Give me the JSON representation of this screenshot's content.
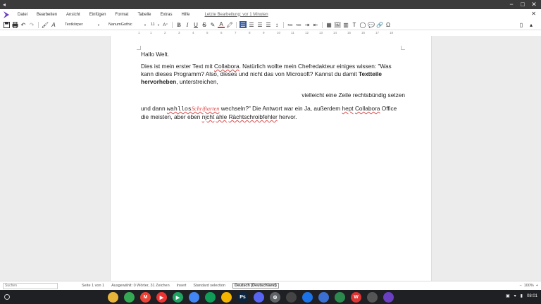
{
  "window": {
    "close_glyph": "✕",
    "min_glyph": "−",
    "max_glyph": "□"
  },
  "menu": {
    "items": [
      "Datei",
      "Bearbeiten",
      "Ansicht",
      "Einfügen",
      "Format",
      "Tabelle",
      "Extras",
      "Hilfe"
    ],
    "last_edit": "Letzte Bearbeitung: vor 1 Minuten",
    "close": "✕"
  },
  "toolbar": {
    "style": "Textkörper",
    "font": "NanumGothic",
    "size": "11"
  },
  "ruler": [
    "1",
    "1",
    "2",
    "3",
    "4",
    "5",
    "6",
    "7",
    "8",
    "9",
    "10",
    "11",
    "12",
    "13",
    "14",
    "15",
    "16",
    "17",
    "18"
  ],
  "document": {
    "line1": "Hallo Welt.",
    "p2_a": "Dies ist mein erster Text mit ",
    "p2_collabora": "Collabora",
    "p2_b": ". Natürlich wollte mein Chefredakteur einiges wissen: \"Was kann dieses Programm? Also, dieses und nicht das von Microsoft? Kannst du damit ",
    "p2_bold": "Textteile hervorheben",
    "p2_c": ", unterstreichen,",
    "p3": "vielleicht eine Zeile rechtsbündig setzen",
    "p4_a": "und dann ",
    "p4_mono": "wahllos",
    "p4_script": "Schriftarten",
    "p4_b": " wechseln?\" Die Antwort war ein Ja, außerdem ",
    "p4_hept": "hept",
    "p4_c": " ",
    "p4_collabora": "Collabora",
    "p4_d": " Office die meisten, aber eben ",
    "p4_njcht": "njcht",
    "p4_e": " ",
    "p4_ahle": "ahle",
    "p4_f": " ",
    "p4_rachts": "Rächtschroibfehler",
    "p4_g": " hervor."
  },
  "status": {
    "search_placeholder": "Suchen",
    "page": "Seite 1 von 1",
    "selection": "Ausgewählt: 0 Wörter, 31 Zeichen",
    "mode": "Insert",
    "sel_mode": "Standard selection",
    "language": "Deutsch (Deutschland)",
    "zoom": "100%"
  },
  "taskbar": {
    "time": "08:01",
    "apps": [
      {
        "name": "chrome",
        "color": "#e8b53b",
        "glyph": ""
      },
      {
        "name": "drive",
        "color": "#34a853",
        "glyph": ""
      },
      {
        "name": "gmail",
        "color": "#ea4335",
        "glyph": "M"
      },
      {
        "name": "youtube",
        "color": "#e33",
        "glyph": "▶"
      },
      {
        "name": "play-store",
        "color": "#1ea362",
        "glyph": "▶"
      },
      {
        "name": "docs",
        "color": "#4285f4",
        "glyph": ""
      },
      {
        "name": "sheets",
        "color": "#0f9d58",
        "glyph": ""
      },
      {
        "name": "slides",
        "color": "#f4b400",
        "glyph": ""
      },
      {
        "name": "photoshop",
        "color": "#0b2540",
        "glyph": "Ps"
      },
      {
        "name": "discord",
        "color": "#5865f2",
        "glyph": ""
      },
      {
        "name": "settings",
        "color": "#5f6368",
        "glyph": "⚙"
      },
      {
        "name": "camera",
        "color": "#444",
        "glyph": ""
      },
      {
        "name": "files",
        "color": "#1a73e8",
        "glyph": ""
      },
      {
        "name": "app-blue",
        "color": "#3b6fd1",
        "glyph": ""
      },
      {
        "name": "app-green",
        "color": "#2d8a4e",
        "glyph": ""
      },
      {
        "name": "wps",
        "color": "#d33",
        "glyph": "W"
      },
      {
        "name": "app-grey",
        "color": "#555",
        "glyph": ""
      },
      {
        "name": "collabora",
        "color": "#6a3fc2",
        "glyph": ""
      }
    ]
  }
}
